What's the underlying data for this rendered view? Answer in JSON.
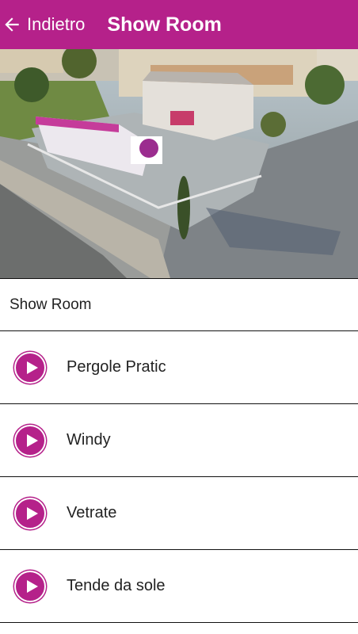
{
  "appbar": {
    "back_label": "Indietro",
    "title": "Show Room",
    "background": "#b5218a"
  },
  "hero": {
    "description_icon": "showroom-aerial-photo"
  },
  "section": {
    "title": "Show Room"
  },
  "items": [
    {
      "label": "Pergole Pratic",
      "icon": "play-icon"
    },
    {
      "label": "Windy",
      "icon": "play-icon"
    },
    {
      "label": "Vetrate",
      "icon": "play-icon"
    },
    {
      "label": "Tende da sole",
      "icon": "play-icon"
    }
  ],
  "colors": {
    "accent": "#b5218a",
    "divider": "#111111"
  }
}
